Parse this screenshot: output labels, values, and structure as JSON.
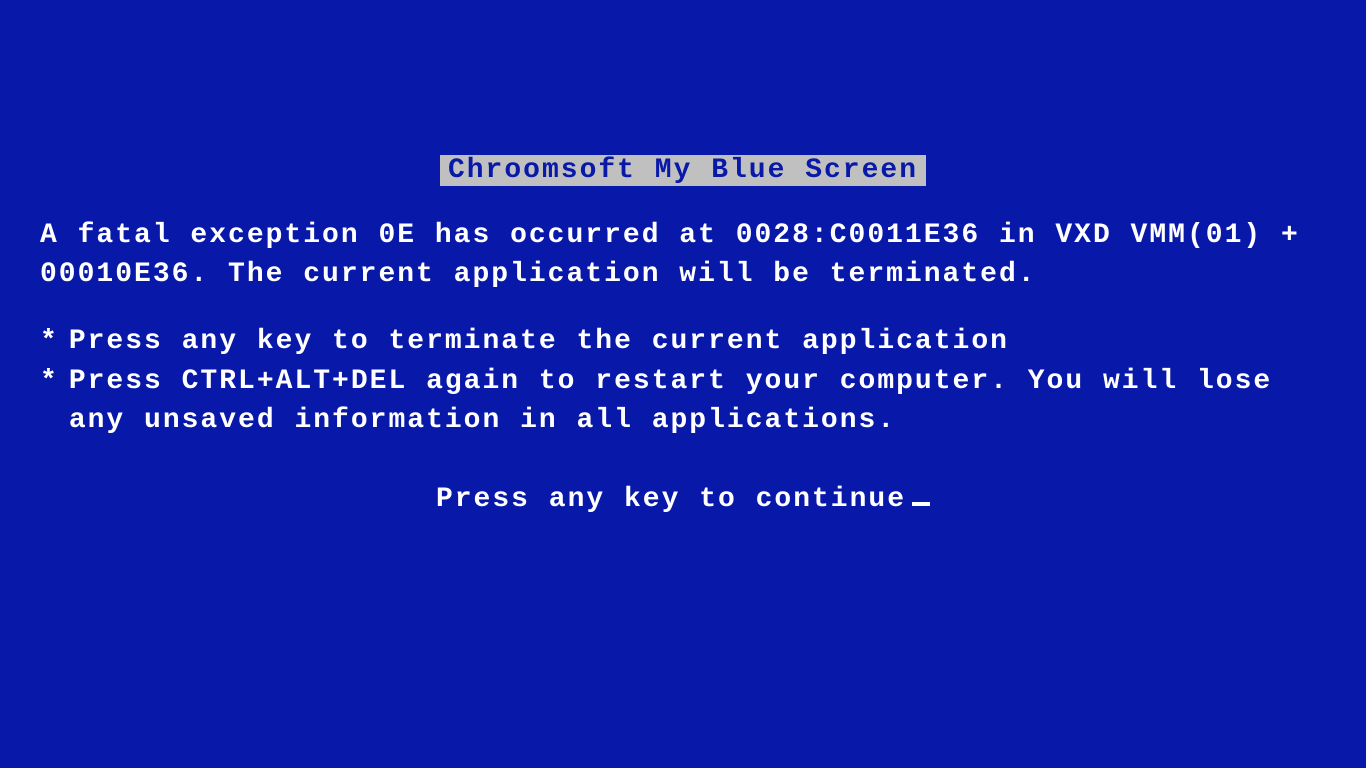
{
  "title": "Chroomsoft My Blue Screen",
  "paragraph": "A fatal exception 0E has occurred at 0028:C0011E36 in VXD VMM(01) + 00010E36. The current application will be terminated.",
  "bullets": [
    "Press any key to terminate the current application",
    "Press CTRL+ALT+DEL again to restart your computer. You will lose any unsaved information in all applications."
  ],
  "continue": "Press any key to continue"
}
